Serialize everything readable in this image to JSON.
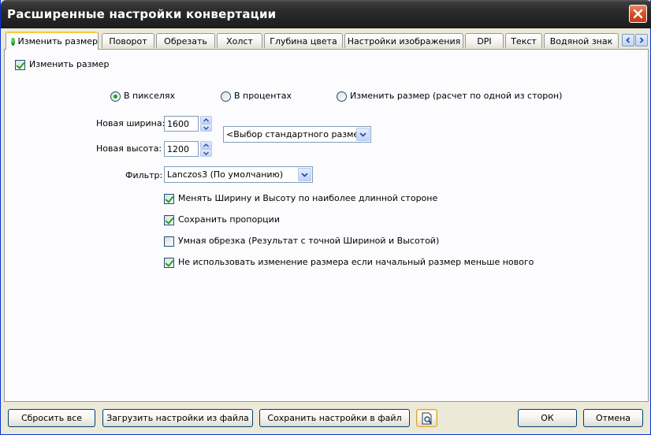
{
  "window": {
    "title": "Расширенные настройки конвертации"
  },
  "tabs": [
    {
      "label": "Изменить размер",
      "active": true
    },
    {
      "label": "Поворот"
    },
    {
      "label": "Обрезать"
    },
    {
      "label": "Холст"
    },
    {
      "label": "Глубина цвета"
    },
    {
      "label": "Настройки изображения"
    },
    {
      "label": "DPI"
    },
    {
      "label": "Текст"
    },
    {
      "label": "Водяной знак"
    }
  ],
  "resize": {
    "enable_label": "Изменить размер",
    "enable_checked": true,
    "modes": [
      {
        "label": "В пикселях",
        "selected": true
      },
      {
        "label": "В процентах",
        "selected": false
      },
      {
        "label": "Изменить размер (расчет по одной из сторон)",
        "selected": false
      }
    ],
    "width_label": "Новая ширина:",
    "width_value": "1600",
    "height_label": "Новая высота:",
    "height_value": "1200",
    "preset_value": "<Выбор стандартного размера>",
    "filter_label": "Фильтр:",
    "filter_value": "Lanczos3 (По умолчанию)",
    "options": [
      {
        "label": "Менять Ширину и Высоту по наиболее длинной стороне",
        "checked": true
      },
      {
        "label": "Сохранить пропорции",
        "checked": true
      },
      {
        "label": "Умная обрезка (Результат с точной Шириной и Высотой)",
        "checked": false
      },
      {
        "label": "Не использовать изменение размера если начальный размер меньше нового",
        "checked": true
      }
    ]
  },
  "footer": {
    "reset_label": "Сбросить все",
    "load_label": "Загрузить настройки из файла",
    "save_label": "Сохранить настройки в файл",
    "preview_icon": "preview-magnifier-icon",
    "ok_label": "ОК",
    "cancel_label": "Отмена"
  },
  "colors": {
    "titlebar": "#2a2a2a",
    "close_button": "#d9532a",
    "dialog_bg": "#ece9d8",
    "active_tab_accent": "#ffc83c",
    "check_green": "#21a121"
  }
}
